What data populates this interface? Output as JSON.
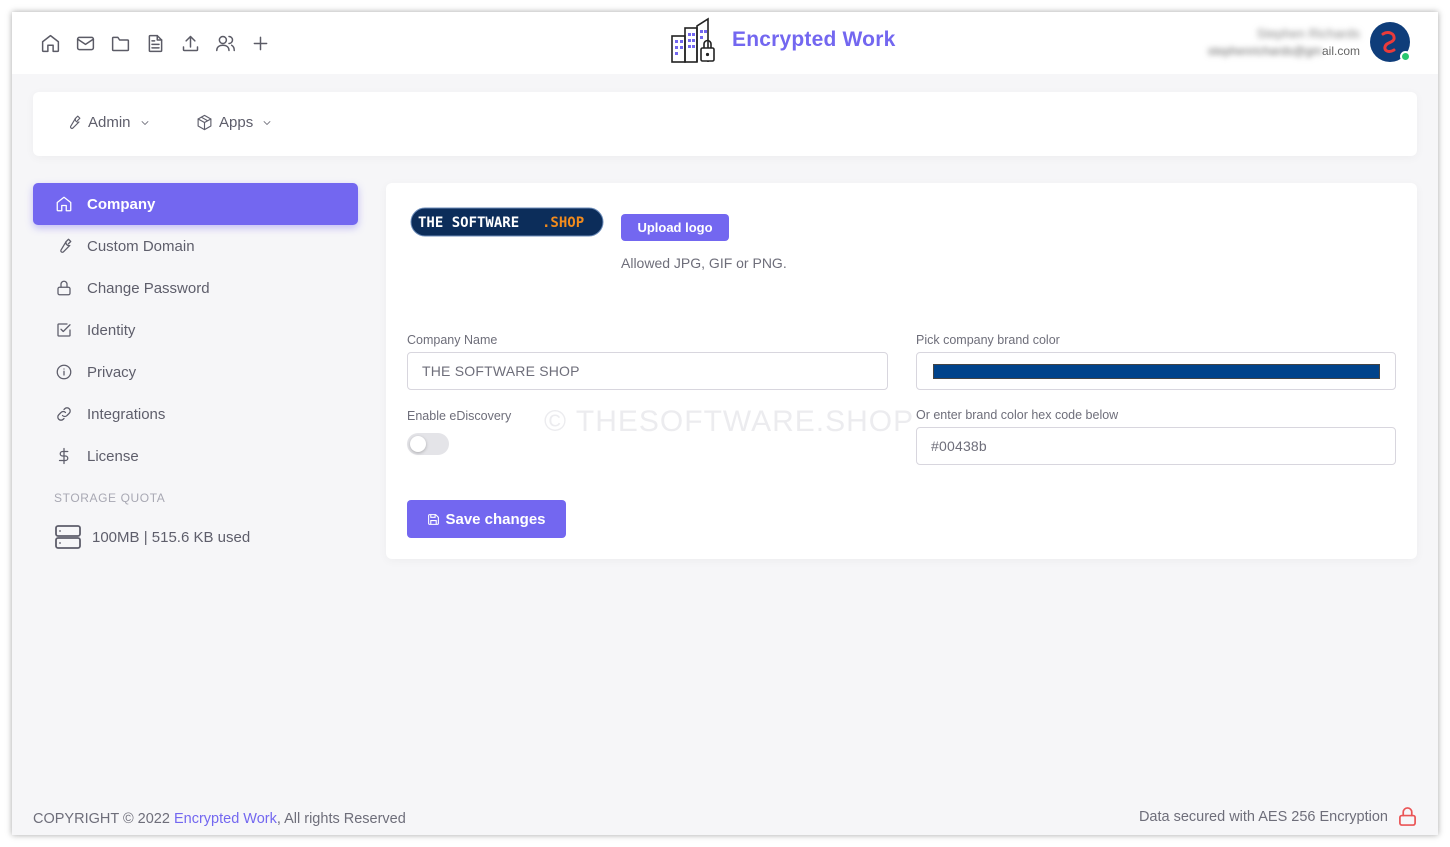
{
  "header": {
    "icons": [
      "home-icon",
      "mail-icon",
      "folder-icon",
      "file-icon",
      "upload-icon",
      "users-icon",
      "plus-icon"
    ],
    "brand": "Encrypted Work",
    "user_name": "Stephen Richards",
    "user_email_hidden": "stephenrichards@gm",
    "user_email_visible": "ail.com"
  },
  "menu": {
    "admin_label": "Admin",
    "apps_label": "Apps"
  },
  "sidebar": {
    "items": [
      {
        "label": "Company",
        "icon": "home-icon"
      },
      {
        "label": "Custom Domain",
        "icon": "wrench-icon"
      },
      {
        "label": "Change Password",
        "icon": "lock-icon"
      },
      {
        "label": "Identity",
        "icon": "check-square-icon"
      },
      {
        "label": "Privacy",
        "icon": "info-icon"
      },
      {
        "label": "Integrations",
        "icon": "link-icon"
      },
      {
        "label": "License",
        "icon": "dollar-icon"
      }
    ],
    "storage_heading": "STORAGE QUOTA",
    "storage_text": "100MB | 515.6 KB used"
  },
  "company": {
    "logo_text_a": "THE SOFTWARE",
    "logo_text_b": ".SHOP",
    "upload_label": "Upload logo",
    "allowed_text": "Allowed JPG, GIF or PNG.",
    "name_label": "Company Name",
    "name_value": "THE SOFTWARE SHOP",
    "brand_color_label": "Pick company brand color",
    "brand_color": "#00438b",
    "ediscovery_label": "Enable eDiscovery",
    "ediscovery_enabled": false,
    "hex_label": "Or enter brand color hex code below",
    "hex_value": "#00438b",
    "save_label": "Save changes",
    "watermark": "© THESOFTWARE.SHOP"
  },
  "footer": {
    "copyright_prefix": "COPYRIGHT © 2022 ",
    "copyright_link": "Encrypted Work",
    "copyright_suffix": ", All rights Reserved",
    "security_text": "Data secured with AES 256 Encryption"
  },
  "colors": {
    "accent": "#7367f0",
    "lock": "#ea5455",
    "online": "#28c76f"
  }
}
